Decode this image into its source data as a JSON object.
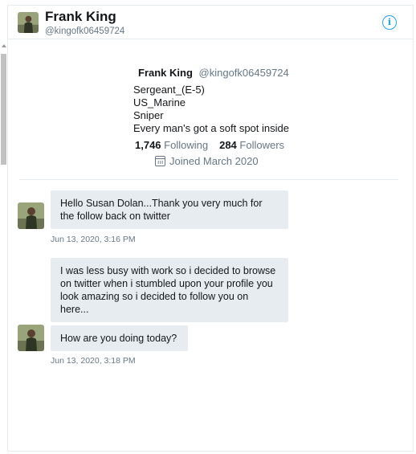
{
  "header": {
    "name": "Frank King",
    "handle": "@kingofk06459724",
    "info_icon": "info-icon"
  },
  "profile": {
    "name": "Frank King",
    "handle": "@kingofk06459724",
    "bio": [
      "Sergeant_(E-5)",
      "US_Marine",
      "Sniper",
      "Every man's got a soft spot inside"
    ],
    "following_count": "1,746",
    "following_label": "Following",
    "followers_count": "284",
    "followers_label": "Followers",
    "joined": "Joined March 2020"
  },
  "messages": [
    {
      "text": "Hello Susan Dolan...Thank you very much for the follow back on twitter",
      "timestamp": "Jun 13, 2020, 3:16 PM"
    },
    {
      "text": "I was less busy with work so i decided to browse on twitter when i stumbled upon your profile you look amazing so i decided to follow you on here..."
    },
    {
      "text": "How are you doing today?",
      "timestamp": "Jun 13, 2020, 3:18 PM"
    }
  ],
  "colors": {
    "accent": "#1da1f2",
    "bubble": "#e6ecf0",
    "secondary_text": "#657786"
  }
}
